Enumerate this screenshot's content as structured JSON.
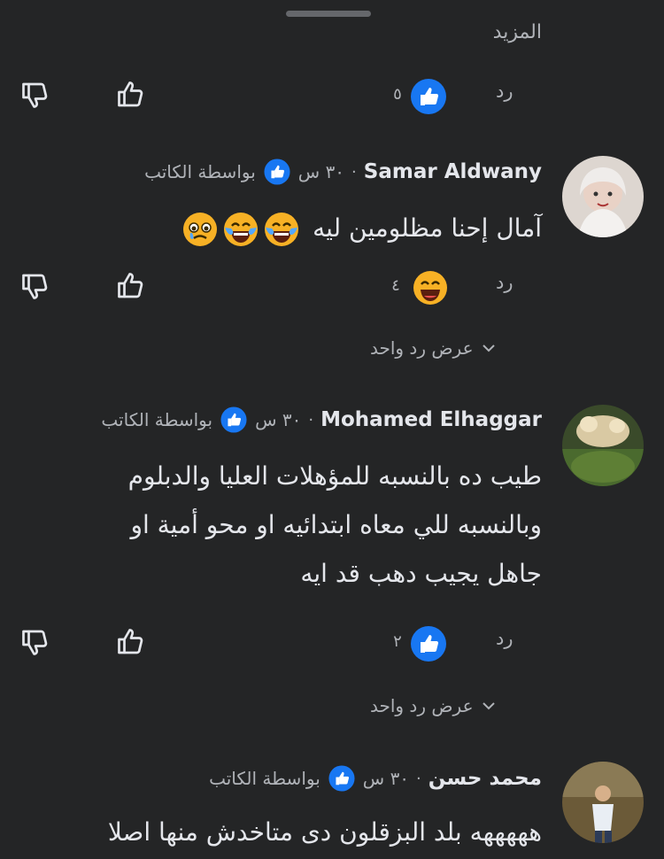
{
  "more_label": "المزيد",
  "reply_label": "رد",
  "by_author_label": "بواسطة الكاتب",
  "view_one_reply": "عرض رد واحد",
  "top_reactions": {
    "count": "٥",
    "icon": "like-reaction-icon"
  },
  "comments": [
    {
      "author": "Samar Aldwany",
      "time": "٣٠ س",
      "text": "آمال إحنا مظلومين ليه",
      "emojis": [
        "laughing-tears-emoji",
        "laughing-tears-emoji",
        "crying-emoji"
      ],
      "reaction_count": "٤",
      "reaction_icon": "haha-reaction-icon"
    },
    {
      "author": "Mohamed Elhaggar",
      "time": "٣٠ س",
      "text_lines": [
        "طيب ده بالنسبه للمؤهلات العليا والدبلوم",
        "وبالنسبه للي معاه ابتدائيه او محو أمية او",
        "جاهل يجيب دهب قد ايه"
      ],
      "reaction_count": "٢",
      "reaction_icon": "like-reaction-icon"
    },
    {
      "author": "محمد حسن",
      "time": "٣٠ س",
      "text": "هههههه بلد البزقلون دى متاخدش منها اصلا"
    }
  ],
  "colors": {
    "background": "#242526",
    "text": "#e4e6eb",
    "secondary_text": "#b0b3b8",
    "like_blue": "#1877f2",
    "haha_yellow": "#f7b125"
  }
}
